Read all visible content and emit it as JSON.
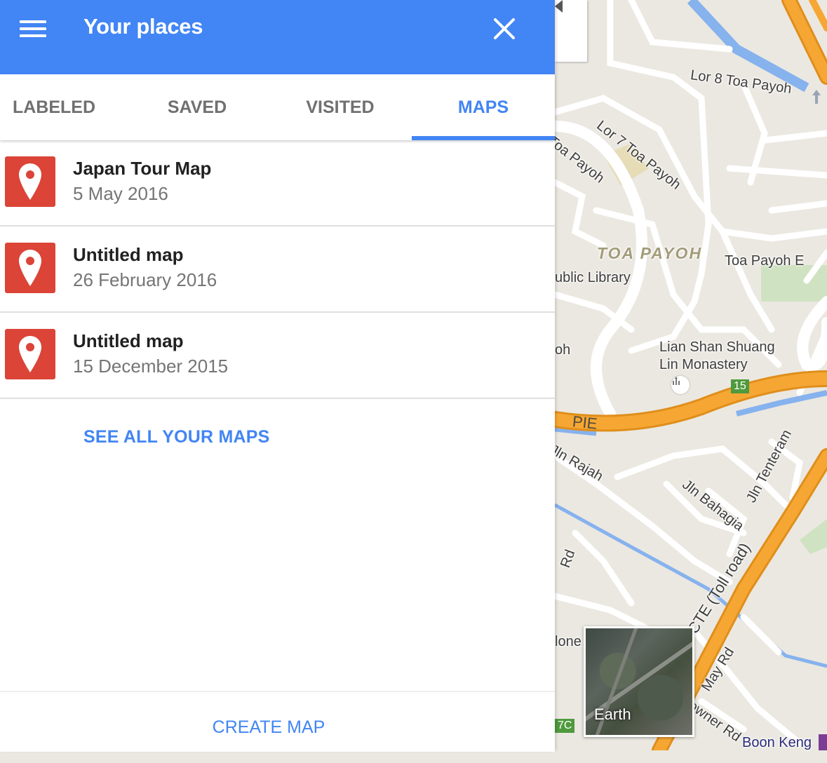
{
  "appbar": {
    "title": "Your places"
  },
  "tabs": [
    {
      "label": "LABELED",
      "active": false
    },
    {
      "label": "SAVED",
      "active": false
    },
    {
      "label": "VISITED",
      "active": false
    },
    {
      "label": "MAPS",
      "active": true
    }
  ],
  "maps": [
    {
      "name": "Japan Tour Map",
      "date": "5 May 2016"
    },
    {
      "name": "Untitled map",
      "date": "26 February 2016"
    },
    {
      "name": "Untitled map",
      "date": "15 December 2015"
    }
  ],
  "see_all_label": "SEE ALL YOUR MAPS",
  "create_map_label": "CREATE MAP",
  "map": {
    "labels": {
      "lor8": "Lor 8 Toa Payoh",
      "lor7": "Lor 7 Toa Payoh",
      "toa_payoh_road": "Toa Payoh",
      "area": "TOA PAYOH",
      "toa_payoh_e": "Toa Payoh E",
      "library": "ublic Library",
      "oh": "oh",
      "monastery": "Lian Shan Shuang Lin Monastery",
      "pie": "PIE",
      "jln_rajah": "Jln Rajah",
      "jln_bahagia": "Jln Bahagia",
      "jln_tenteram": "Jln Tenteram",
      "rd": "Rd",
      "cte": "CTE (Toll road)",
      "mone": "lone",
      "may_rd": "May Rd",
      "owner_rd": "owner Rd",
      "boon_keng": "Boon Keng",
      "badge_15": "15",
      "badge_7c": "7C"
    },
    "earth_label": "Earth"
  },
  "colors": {
    "accent": "#4285f4",
    "pin": "#db4437",
    "expressway": "#f29f2a",
    "water": "#86b2ee",
    "park": "#cfe2c1"
  },
  "icons": {
    "menu": "hamburger-icon",
    "close": "close-icon",
    "collapse": "chevron-left-icon",
    "pin": "map-pin-icon",
    "temple": "temple-icon"
  }
}
